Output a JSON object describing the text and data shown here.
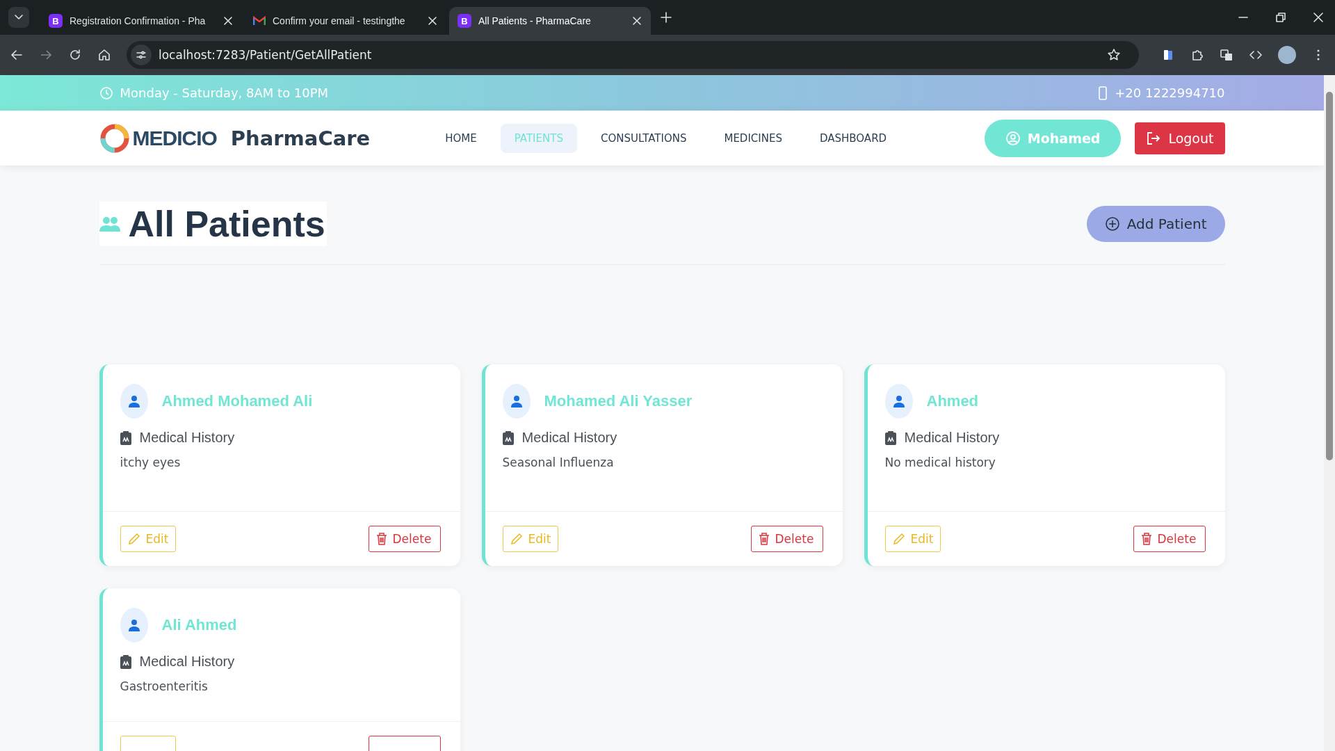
{
  "browser": {
    "tabs": [
      {
        "title": "Registration Confirmation - Pha",
        "kind": "site",
        "icon_letter": "B",
        "selected": false
      },
      {
        "title": "Confirm your email - testingthe",
        "kind": "mail",
        "selected": false
      },
      {
        "title": "All Patients - PharmaCare",
        "kind": "site",
        "icon_letter": "B",
        "selected": true
      }
    ],
    "url": "localhost:7283/Patient/GetAllPatient"
  },
  "topbar": {
    "hours": "Monday - Saturday, 8AM to 10PM",
    "phone": "+20 1222994710"
  },
  "navbar": {
    "logo": "MEDICIO",
    "brand": "PharmaCare",
    "links": [
      {
        "label": "HOME",
        "selected": false
      },
      {
        "label": "PATIENTS",
        "selected": true
      },
      {
        "label": "CONSULTATIONS",
        "selected": false
      },
      {
        "label": "MEDICINES",
        "selected": false
      },
      {
        "label": "DASHBOARD",
        "selected": false
      }
    ],
    "user": "Mohamed",
    "logout": "Logout"
  },
  "page": {
    "title": "All Patients",
    "add_button": "Add Patient"
  },
  "patients": [
    {
      "name": "Ahmed Mohamed Ali",
      "history_label": "Medical History",
      "history": "itchy eyes",
      "edit": "Edit",
      "delete": "Delete"
    },
    {
      "name": "Mohamed Ali Yasser",
      "history_label": "Medical History",
      "history": "Seasonal Influenza",
      "edit": "Edit",
      "delete": "Delete"
    },
    {
      "name": "Ahmed",
      "history_label": "Medical History",
      "history": "No medical history",
      "edit": "Edit",
      "delete": "Delete"
    },
    {
      "name": "Ali Ahmed",
      "history_label": "Medical History",
      "history": "Gastroenteritis"
    }
  ]
}
